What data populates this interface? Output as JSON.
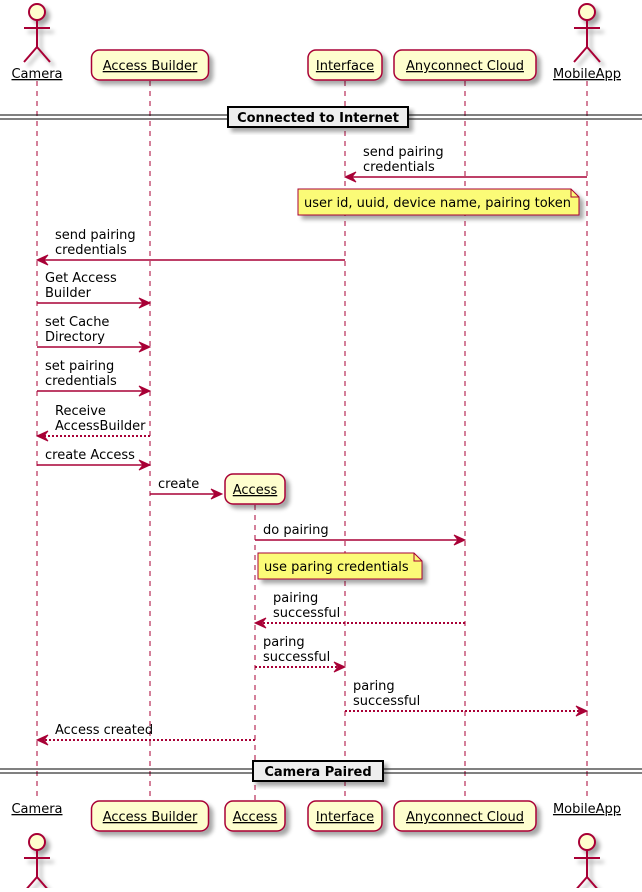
{
  "colors": {
    "border": "#A80036",
    "participant_fill": "#FEFECE",
    "note_fill": "#FBFB77",
    "divider_fill": "#EEEEEE",
    "text": "#000000"
  },
  "participants": [
    {
      "id": "camera",
      "label": "Camera",
      "kind": "actor"
    },
    {
      "id": "access_builder",
      "label": "Access Builder",
      "kind": "participant"
    },
    {
      "id": "access",
      "label": "Access",
      "kind": "participant",
      "created": true
    },
    {
      "id": "interface",
      "label": "Interface",
      "kind": "participant"
    },
    {
      "id": "cloud",
      "label": "Anyconnect Cloud",
      "kind": "participant"
    },
    {
      "id": "mobile",
      "label": "MobileApp",
      "kind": "actor"
    }
  ],
  "dividers": [
    {
      "label": "Connected to Internet"
    },
    {
      "label": "Camera Paired"
    }
  ],
  "messages": [
    {
      "from": "mobile",
      "to": "interface",
      "lines": [
        "send pairing",
        "credentials"
      ],
      "style": "solid"
    },
    {
      "from": "interface",
      "to": "camera",
      "lines": [
        "send pairing",
        "credentials"
      ],
      "style": "solid"
    },
    {
      "from": "camera",
      "to": "access_builder",
      "lines": [
        "Get Access",
        "Builder"
      ],
      "style": "solid"
    },
    {
      "from": "camera",
      "to": "access_builder",
      "lines": [
        "set Cache",
        "Directory"
      ],
      "style": "solid"
    },
    {
      "from": "camera",
      "to": "access_builder",
      "lines": [
        "set pairing",
        "credentials"
      ],
      "style": "solid"
    },
    {
      "from": "access_builder",
      "to": "camera",
      "lines": [
        "Receive",
        "AccessBuilder"
      ],
      "style": "dotted"
    },
    {
      "from": "camera",
      "to": "access_builder",
      "lines": [
        "create Access"
      ],
      "style": "solid"
    },
    {
      "from": "access_builder",
      "to": "access",
      "lines": [
        "create"
      ],
      "style": "solid"
    },
    {
      "from": "access",
      "to": "cloud",
      "lines": [
        "do pairing"
      ],
      "style": "solid"
    },
    {
      "from": "cloud",
      "to": "access",
      "lines": [
        "pairing",
        "successful"
      ],
      "style": "dotted"
    },
    {
      "from": "access",
      "to": "interface",
      "lines": [
        "paring",
        "successful"
      ],
      "style": "dotted"
    },
    {
      "from": "interface",
      "to": "mobile",
      "lines": [
        "paring",
        "successful"
      ],
      "style": "dotted"
    },
    {
      "from": "access",
      "to": "camera",
      "lines": [
        "Access created"
      ],
      "style": "dotted"
    }
  ],
  "notes": [
    {
      "text": "user id, uuid, device name, pairing token"
    },
    {
      "text": "use paring credentials"
    }
  ]
}
